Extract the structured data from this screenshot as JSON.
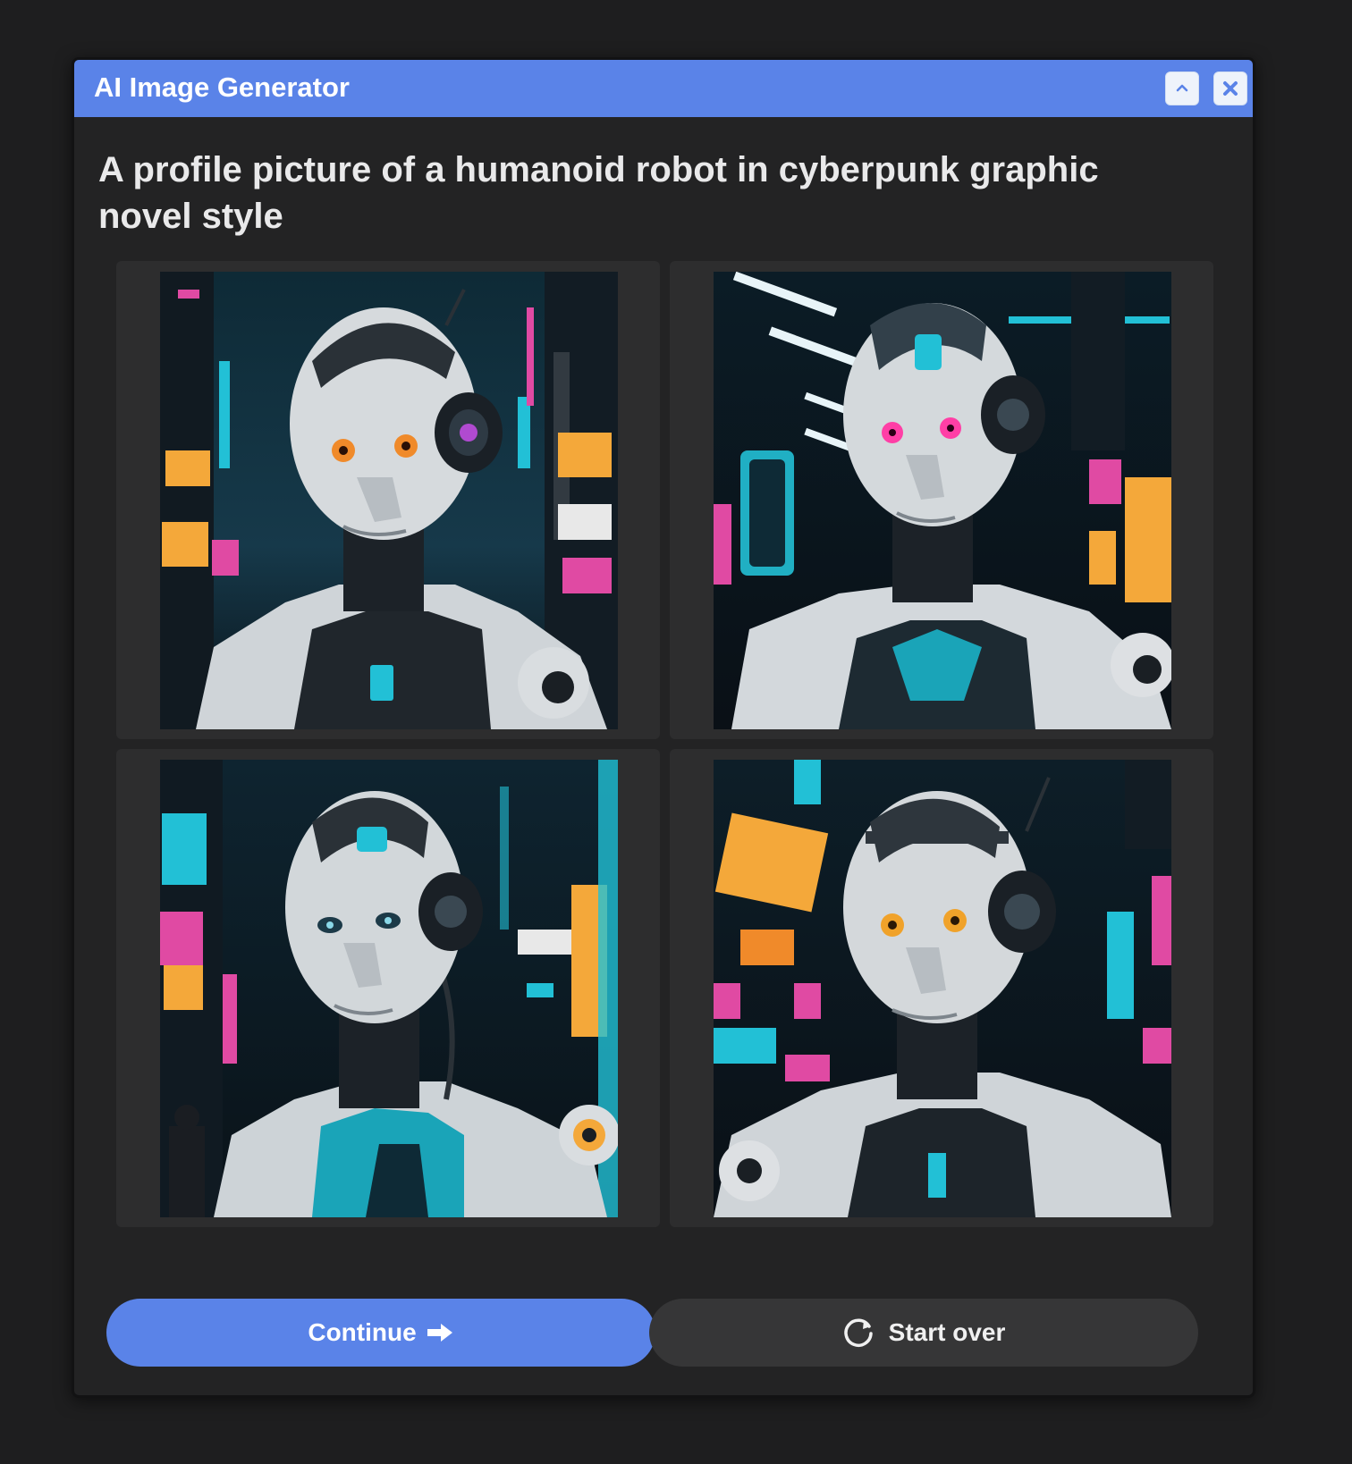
{
  "window": {
    "title": "AI Image Generator"
  },
  "prompt": {
    "text": "A profile picture of a humanoid robot in cyberpunk graphic novel style"
  },
  "images": [
    {
      "icon": "generated-image-robot"
    },
    {
      "icon": "generated-image-robot"
    },
    {
      "icon": "generated-image-robot"
    },
    {
      "icon": "generated-image-robot"
    }
  ],
  "actions": {
    "continue_label": "Continue",
    "start_over_label": "Start over"
  },
  "colors": {
    "accent": "#5a83e8",
    "background": "#1e1e1f",
    "panel": "#232324",
    "tile": "#2d2d2e",
    "secondary_button": "#363637"
  }
}
